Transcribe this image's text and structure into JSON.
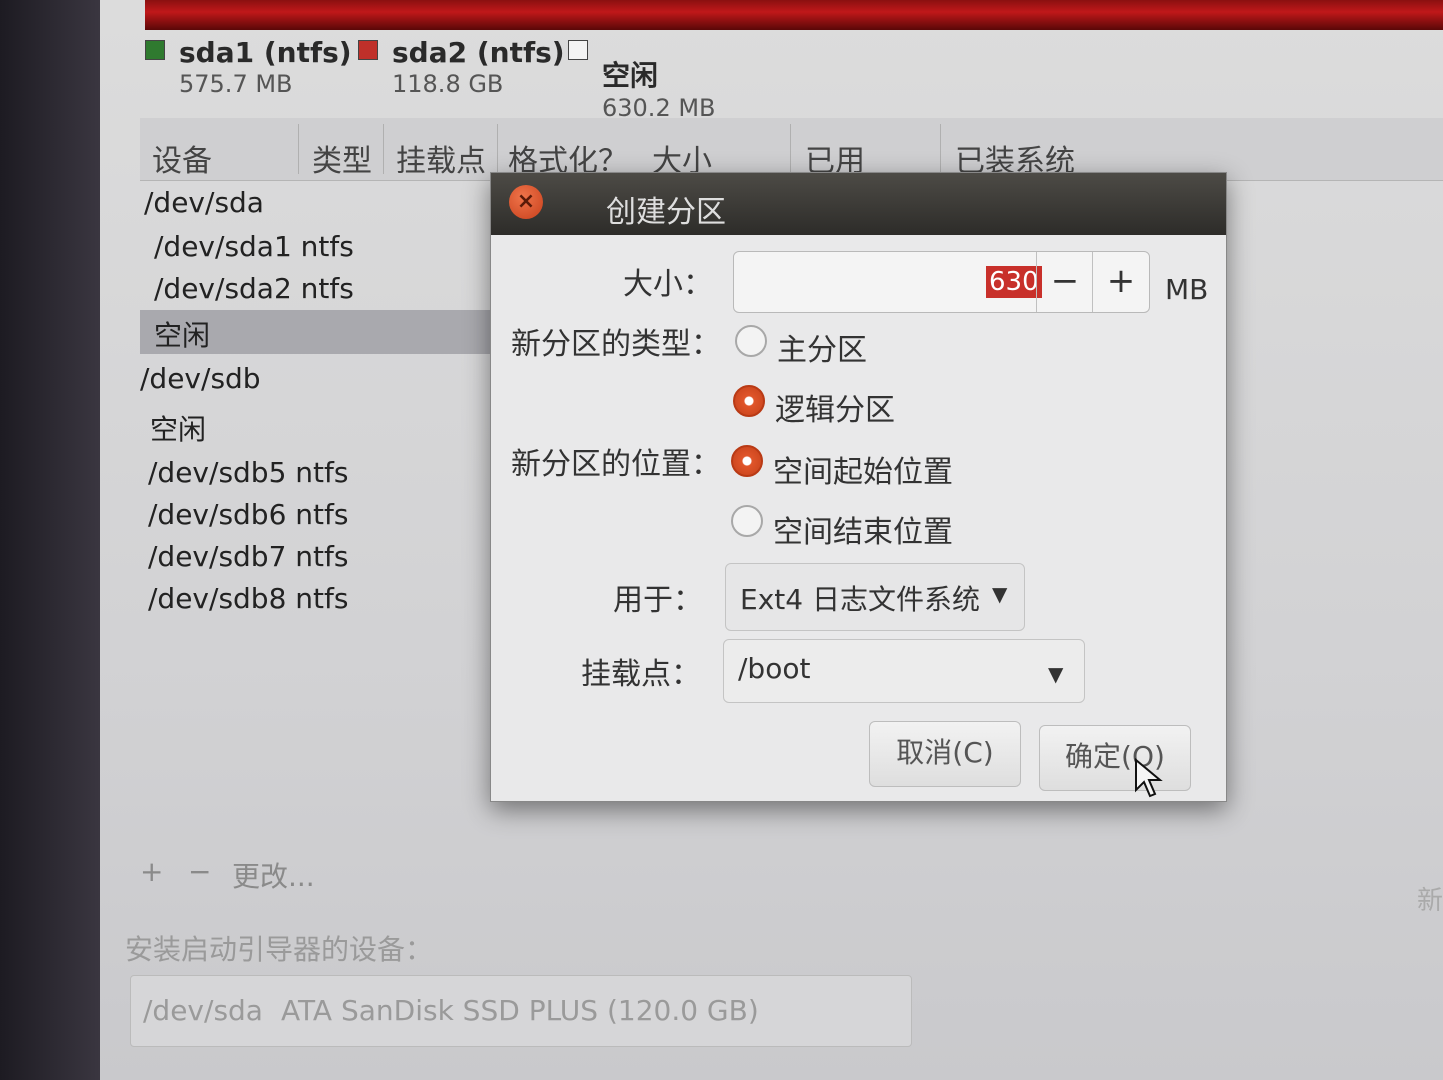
{
  "partitions_legend": [
    {
      "name": "sda1 (ntfs)",
      "size": "575.7 MB",
      "color": "#2f7a2f"
    },
    {
      "name": "sda2 (ntfs)",
      "size": "118.8 GB",
      "color": "#c0302a"
    },
    {
      "name": "空闲",
      "size": "630.2 MB",
      "color": "#f4f4f4"
    }
  ],
  "table": {
    "columns": [
      "设备",
      "类型",
      "挂载点",
      "格式化？",
      "大小",
      "已用",
      "已装系统"
    ]
  },
  "devices": [
    {
      "label": "/dev/sda"
    },
    {
      "label": "/dev/sda1 ntfs"
    },
    {
      "label": "/dev/sda2 ntfs"
    },
    {
      "label": "空闲",
      "selected": true
    },
    {
      "label": "/dev/sdb"
    },
    {
      "label": "空闲"
    },
    {
      "label": "/dev/sdb5 ntfs"
    },
    {
      "label": "/dev/sdb6 ntfs"
    },
    {
      "label": "/dev/sdb7 ntfs"
    },
    {
      "label": "/dev/sdb8 ntfs"
    }
  ],
  "bottom": {
    "add": "+",
    "remove": "−",
    "change": "更改...",
    "boot_loader_label": "安装启动引导器的设备：",
    "boot_loader_device": "/dev/sda",
    "boot_loader_desc": "ATA SanDisk SSD PLUS (120.0 GB)",
    "right_edge": "新"
  },
  "dialog": {
    "title": "创建分区",
    "size_label": "大小：",
    "size_value": "630",
    "minus": "−",
    "plus": "+",
    "unit": "MB",
    "type_label": "新分区的类型：",
    "type_primary": "主分区",
    "type_logical": "逻辑分区",
    "type_selected": "logical",
    "location_label": "新分区的位置：",
    "location_start": "空间起始位置",
    "location_end": "空间结束位置",
    "location_selected": "start",
    "use_as_label": "用于：",
    "use_as_value": "Ext4 日志文件系统",
    "mount_label": "挂载点：",
    "mount_value": "/boot",
    "cancel": "取消(C)",
    "ok": "确定(O)"
  }
}
